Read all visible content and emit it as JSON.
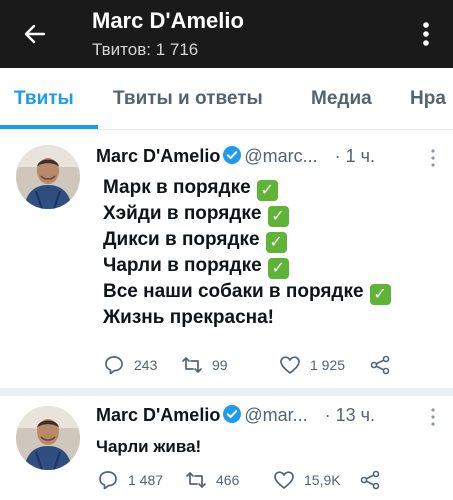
{
  "header": {
    "name": "Marc D'Amelio",
    "tweet_count": "Твитов: 1 716",
    "back_icon": "arrow-left-icon",
    "menu_icon": "more-vertical-icon"
  },
  "tabs": [
    {
      "label": "Твиты",
      "active": true
    },
    {
      "label": "Твиты и ответы",
      "active": false
    },
    {
      "label": "Медиа",
      "active": false
    },
    {
      "label": "Нра",
      "active": false
    }
  ],
  "colors": {
    "accent": "#1d9bf0",
    "topbar": "#1a1a1a",
    "check_emoji": "#5fb336",
    "muted": "#536471"
  },
  "tweets": [
    {
      "author": "Marc D'Amelio",
      "handle": "@marc...",
      "separator": "·",
      "time": "1 ч.",
      "lines": [
        {
          "text": "Марк в порядке",
          "emoji": "✓"
        },
        {
          "text": "Хэйди в порядке",
          "emoji": "✓"
        },
        {
          "text": "Дикси в порядке",
          "emoji": "✓"
        },
        {
          "text": "Чарли в порядке",
          "emoji": "✓"
        },
        {
          "text": "Все наши собаки в порядке",
          "emoji": "✓"
        },
        {
          "text": "Жизнь прекрасна!",
          "emoji": ""
        }
      ],
      "replies": "243",
      "retweets": "99",
      "likes": "1 925"
    },
    {
      "author": "Marc D'Amelio",
      "handle": "@mar...",
      "separator": "·",
      "time": "13 ч.",
      "lines": [
        {
          "text": "Чарли жива!",
          "emoji": ""
        }
      ],
      "replies": "1 487",
      "retweets": "466",
      "likes": "15,9K"
    }
  ]
}
